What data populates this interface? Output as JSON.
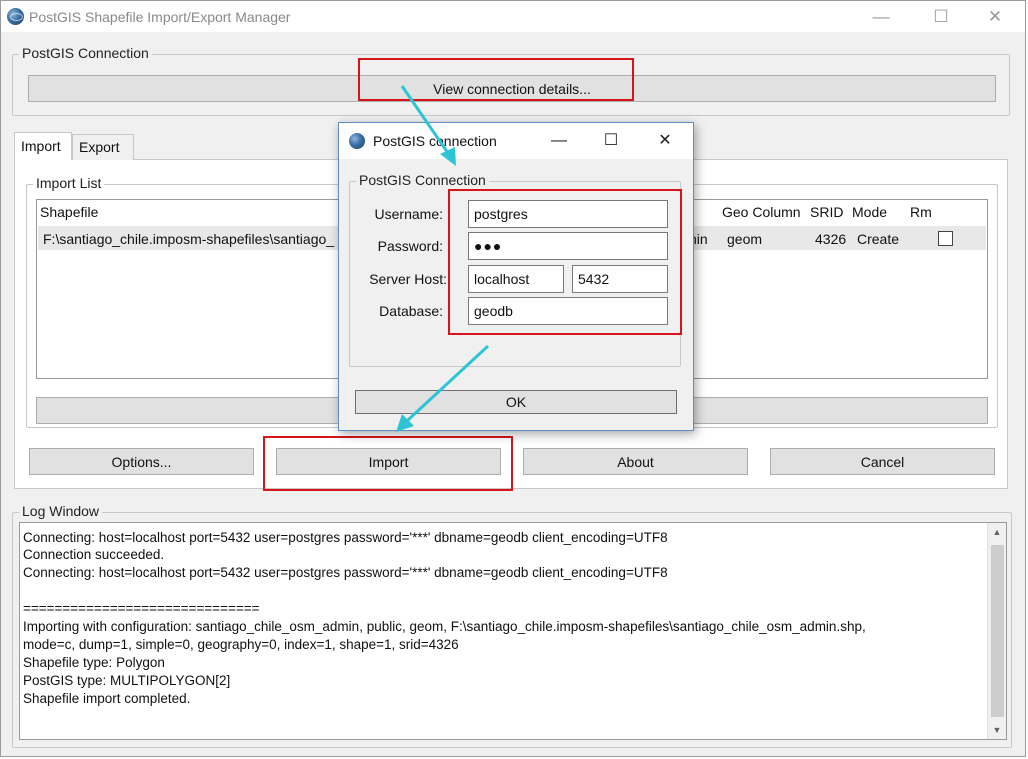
{
  "window": {
    "title": "PostGIS Shapefile Import/Export Manager",
    "minimize_glyph": "—",
    "maximize_glyph": "☐",
    "close_glyph": "✕"
  },
  "connection_group": {
    "label": "PostGIS Connection",
    "view_details_button": "View connection details..."
  },
  "tabs": [
    {
      "label": "Import",
      "active": true
    },
    {
      "label": "Export",
      "active": false
    }
  ],
  "import_list": {
    "label": "Import List",
    "columns": [
      "Shapefile",
      "Geo Column",
      "SRID",
      "Mode",
      "Rm"
    ],
    "rows": [
      {
        "shapefile": "F:\\santiago_chile.imposm-shapefiles\\santiago_",
        "table_tail": "nin",
        "geo_column": "geom",
        "srid": "4326",
        "mode": "Create",
        "rm": false
      }
    ]
  },
  "buttons": {
    "options": "Options...",
    "import": "Import",
    "about": "About",
    "cancel": "Cancel"
  },
  "log_window": {
    "label": "Log Window",
    "lines": [
      "Connecting:  host=localhost port=5432 user=postgres password='***' dbname=geodb client_encoding=UTF8",
      "Connection succeeded.",
      "Connecting:  host=localhost port=5432 user=postgres password='***' dbname=geodb client_encoding=UTF8",
      "",
      "==============================",
      "Importing with configuration: santiago_chile_osm_admin, public, geom, F:\\santiago_chile.imposm-shapefiles\\santiago_chile_osm_admin.shp,",
      "mode=c, dump=1, simple=0, geography=0, index=1, shape=1, srid=4326",
      "Shapefile type: Polygon",
      "PostGIS type: MULTIPOLYGON[2]",
      "Shapefile import completed."
    ]
  },
  "dialog": {
    "title": "PostGIS connection",
    "group_label": "PostGIS Connection",
    "username_label": "Username:",
    "username_value": "postgres",
    "password_label": "Password:",
    "password_value": "●●●",
    "host_label": "Server Host:",
    "host_value": "localhost",
    "port_value": "5432",
    "database_label": "Database:",
    "database_value": "geodb",
    "ok_button": "OK",
    "minimize_glyph": "—",
    "maximize_glyph": "☐",
    "close_glyph": "✕"
  },
  "colors": {
    "highlight": "#d7141a",
    "arrow": "#2ec4d6",
    "dialog_border": "#5f8fc2"
  }
}
